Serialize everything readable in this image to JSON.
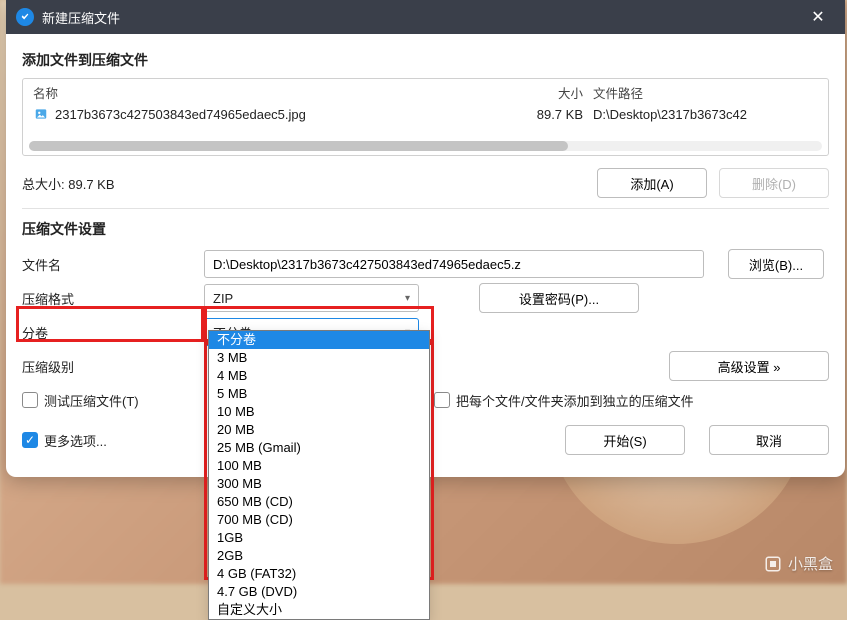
{
  "titlebar": {
    "title": "新建压缩文件"
  },
  "section_add": {
    "heading": "添加文件到压缩文件",
    "columns": {
      "name": "名称",
      "size": "大小",
      "path": "文件路径"
    },
    "rows": [
      {
        "name": "2317b3673c427503843ed74965edaec5.jpg",
        "size": "89.7 KB",
        "path": "D:\\Desktop\\2317b3673c42"
      }
    ],
    "total_label": "总大小:",
    "total_value": "89.7 KB",
    "add_btn": "添加(A)",
    "remove_btn": "删除(D)"
  },
  "section_settings": {
    "heading": "压缩文件设置",
    "filename_label": "文件名",
    "filename_value": "D:\\Desktop\\2317b3673c427503843ed74965edaec5.z",
    "browse_btn": "浏览(B)...",
    "format_label": "压缩格式",
    "format_value": "ZIP",
    "set_password_btn": "设置密码(P)...",
    "split_label": "分卷",
    "split_value": "不分卷",
    "level_label": "压缩级别",
    "advanced_btn": "高级设置 »",
    "test_checkbox": "测试压缩文件(T)",
    "separate_checkbox": "把每个文件/文件夹添加到独立的压缩文件",
    "more_options": "更多选项...",
    "start_btn": "开始(S)",
    "cancel_btn": "取消"
  },
  "split_options": [
    "不分卷",
    "3 MB",
    "4 MB",
    "5 MB",
    "10 MB",
    "20 MB",
    "25 MB (Gmail)",
    "100 MB",
    "300 MB",
    "650 MB (CD)",
    "700 MB (CD)",
    "1GB",
    "2GB",
    "4 GB (FAT32)",
    "4.7 GB (DVD)",
    "自定义大小"
  ],
  "split_selected_index": 0,
  "watermark": "小黑盒"
}
